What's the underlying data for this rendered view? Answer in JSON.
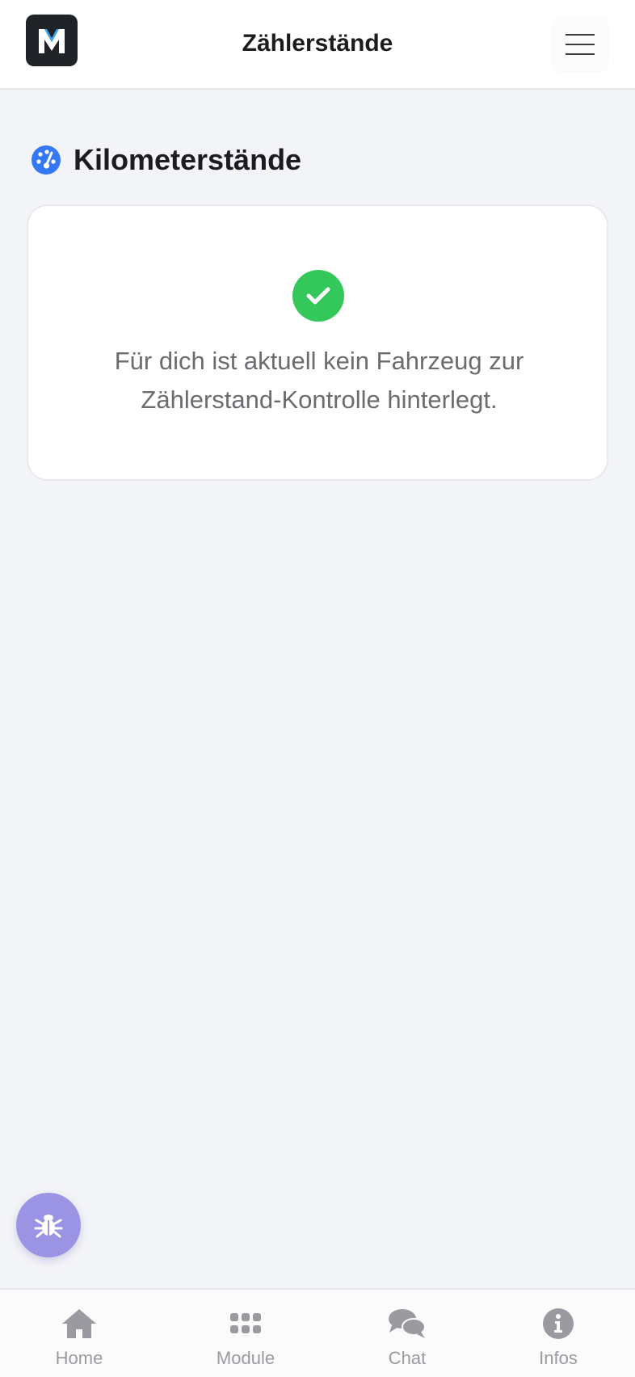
{
  "header": {
    "logo_letter": "M",
    "title": "Zählerstände",
    "menu_icon": "hamburger-icon"
  },
  "section": {
    "icon": "speedometer-icon",
    "title": "Kilometerstände"
  },
  "status_card": {
    "icon": "check-circle-icon",
    "message": "Für dich ist aktuell kein Fahrzeug zur Zählerstand-Kontrolle hinterlegt."
  },
  "debug_button": {
    "icon": "bug-icon"
  },
  "tabbar": {
    "items": [
      {
        "label": "Home",
        "icon": "home-icon"
      },
      {
        "label": "Module",
        "icon": "grid-icon"
      },
      {
        "label": "Chat",
        "icon": "chat-icon"
      },
      {
        "label": "Infos",
        "icon": "info-icon"
      }
    ]
  },
  "colors": {
    "accent_blue": "#3478f6",
    "success_green": "#34c759",
    "debug_purple": "#9b93e3",
    "tab_inactive": "#9a9aa0"
  }
}
